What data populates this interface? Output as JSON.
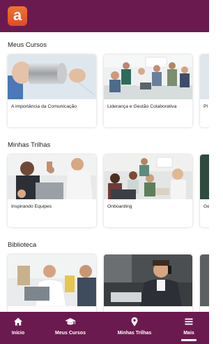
{
  "header": {
    "logo_letter": "a",
    "brand_color": "#6b1a4f",
    "logo_color": "#ec5a2c"
  },
  "sections": [
    {
      "title": "Meus Cursos",
      "cards": [
        {
          "label": "A importância da Comunicação",
          "thumb": "can-phone-image"
        },
        {
          "label": "Liderança e Gestão Colaborativa",
          "thumb": "office-team-image"
        },
        {
          "label": "Pl",
          "thumb": "partial-image"
        }
      ]
    },
    {
      "title": "Minhas Trilhas",
      "cards": [
        {
          "label": "Inspirando Equipes",
          "thumb": "team-highfive-image"
        },
        {
          "label": "Onboarding",
          "thumb": "meeting-laptop-image"
        },
        {
          "label": "Ge",
          "thumb": "partial-image"
        }
      ]
    },
    {
      "title": "Biblioteca",
      "cards": [
        {
          "label": "",
          "thumb": "man-laptop-image"
        },
        {
          "label": "",
          "thumb": "man-phone-image"
        },
        {
          "label": "",
          "thumb": "partial-image"
        }
      ]
    }
  ],
  "nav": {
    "items": [
      {
        "label": "Início",
        "icon": "home-icon"
      },
      {
        "label": "Meus Cursos",
        "icon": "graduation-cap-icon"
      },
      {
        "label": "Minhas Trilhas",
        "icon": "map-pin-icon"
      },
      {
        "label": "Mais",
        "icon": "menu-icon"
      }
    ],
    "active_index": 3
  }
}
